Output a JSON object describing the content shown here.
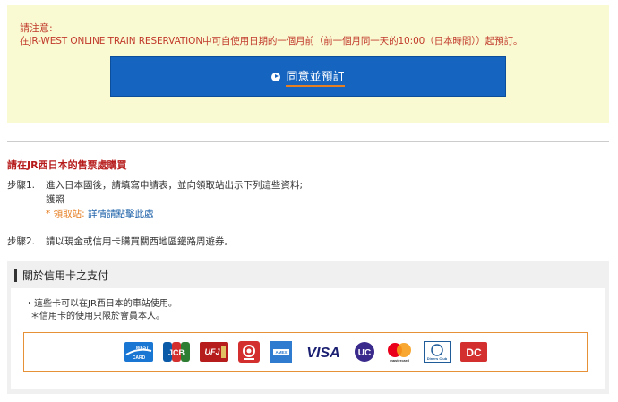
{
  "notice": {
    "heading": "請注意:",
    "text": "在JR-WEST ONLINE TRAIN RESERVATION中可自使用日期的一個月前（前一個月同一天的10:00（日本時間））起預訂。",
    "agree_button": "同意並預訂"
  },
  "ticket_office": {
    "title": "請在JR西日本的售票處購買",
    "step1_label": "步驟1.",
    "step1_text": "進入日本國後，請填寫申請表，並向領取站出示下列這些資料;",
    "step1_passport": "護照",
    "pickup_label": "* 領取站:",
    "pickup_link": "詳情請點擊此處",
    "step2_label": "步驟2.",
    "step2_text": "請以現金或信用卡購買關西地區鐵路周遊券。"
  },
  "credit_card": {
    "heading": "關於信用卡之支付",
    "note1": "・這些卡可以在JR西日本的車站使用。",
    "note2": "＊信用卡的使用只限於會員本人。",
    "logos": [
      {
        "name": "J-WEST CARD",
        "text": "WEST",
        "color": "#1976d2"
      },
      {
        "name": "JCB",
        "text": "JCB",
        "color": "#0b5aa8"
      },
      {
        "name": "UFJ CARD",
        "text": "UFJ",
        "color": "#b71c1c"
      },
      {
        "name": "Saison",
        "text": "◎",
        "color": "#d32f2f"
      },
      {
        "name": "American Express",
        "text": "AMEX",
        "color": "#2e7bcf"
      },
      {
        "name": "VISA",
        "text": "VISA",
        "color": "#1a1f71"
      },
      {
        "name": "UC",
        "text": "UC",
        "color": "#3a2a8c"
      },
      {
        "name": "Mastercard",
        "text": "mastercard",
        "color": "#eb001b"
      },
      {
        "name": "Diners Club",
        "text": "Diners Club",
        "color": "#1f5c99"
      },
      {
        "name": "DC",
        "text": "DC",
        "color": "#d32f2f"
      }
    ]
  }
}
